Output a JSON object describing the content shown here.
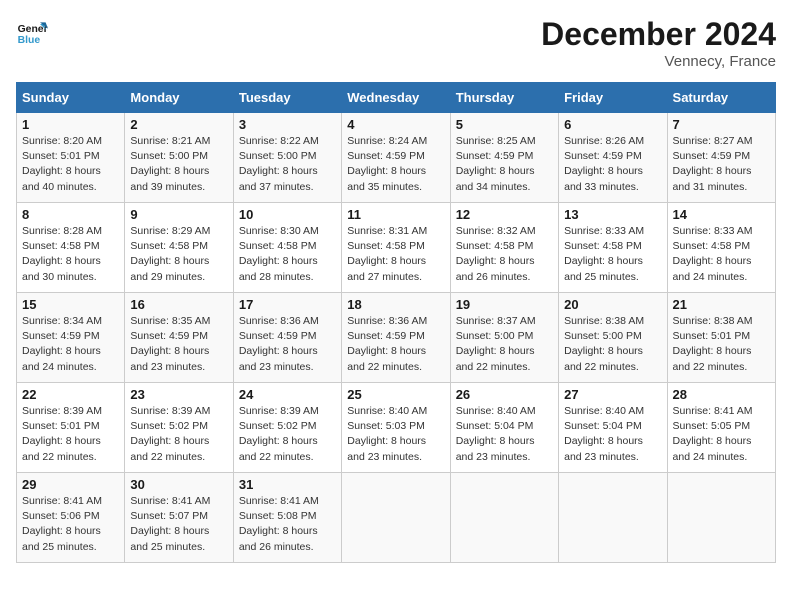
{
  "header": {
    "logo_line1": "General",
    "logo_line2": "Blue",
    "month": "December 2024",
    "location": "Vennecy, France"
  },
  "days_of_week": [
    "Sunday",
    "Monday",
    "Tuesday",
    "Wednesday",
    "Thursday",
    "Friday",
    "Saturday"
  ],
  "weeks": [
    [
      {
        "day": "1",
        "sunrise": "8:20 AM",
        "sunset": "5:01 PM",
        "daylight": "8 hours and 40 minutes."
      },
      {
        "day": "2",
        "sunrise": "8:21 AM",
        "sunset": "5:00 PM",
        "daylight": "8 hours and 39 minutes."
      },
      {
        "day": "3",
        "sunrise": "8:22 AM",
        "sunset": "5:00 PM",
        "daylight": "8 hours and 37 minutes."
      },
      {
        "day": "4",
        "sunrise": "8:24 AM",
        "sunset": "4:59 PM",
        "daylight": "8 hours and 35 minutes."
      },
      {
        "day": "5",
        "sunrise": "8:25 AM",
        "sunset": "4:59 PM",
        "daylight": "8 hours and 34 minutes."
      },
      {
        "day": "6",
        "sunrise": "8:26 AM",
        "sunset": "4:59 PM",
        "daylight": "8 hours and 33 minutes."
      },
      {
        "day": "7",
        "sunrise": "8:27 AM",
        "sunset": "4:59 PM",
        "daylight": "8 hours and 31 minutes."
      }
    ],
    [
      {
        "day": "8",
        "sunrise": "8:28 AM",
        "sunset": "4:58 PM",
        "daylight": "8 hours and 30 minutes."
      },
      {
        "day": "9",
        "sunrise": "8:29 AM",
        "sunset": "4:58 PM",
        "daylight": "8 hours and 29 minutes."
      },
      {
        "day": "10",
        "sunrise": "8:30 AM",
        "sunset": "4:58 PM",
        "daylight": "8 hours and 28 minutes."
      },
      {
        "day": "11",
        "sunrise": "8:31 AM",
        "sunset": "4:58 PM",
        "daylight": "8 hours and 27 minutes."
      },
      {
        "day": "12",
        "sunrise": "8:32 AM",
        "sunset": "4:58 PM",
        "daylight": "8 hours and 26 minutes."
      },
      {
        "day": "13",
        "sunrise": "8:33 AM",
        "sunset": "4:58 PM",
        "daylight": "8 hours and 25 minutes."
      },
      {
        "day": "14",
        "sunrise": "8:33 AM",
        "sunset": "4:58 PM",
        "daylight": "8 hours and 24 minutes."
      }
    ],
    [
      {
        "day": "15",
        "sunrise": "8:34 AM",
        "sunset": "4:59 PM",
        "daylight": "8 hours and 24 minutes."
      },
      {
        "day": "16",
        "sunrise": "8:35 AM",
        "sunset": "4:59 PM",
        "daylight": "8 hours and 23 minutes."
      },
      {
        "day": "17",
        "sunrise": "8:36 AM",
        "sunset": "4:59 PM",
        "daylight": "8 hours and 23 minutes."
      },
      {
        "day": "18",
        "sunrise": "8:36 AM",
        "sunset": "4:59 PM",
        "daylight": "8 hours and 22 minutes."
      },
      {
        "day": "19",
        "sunrise": "8:37 AM",
        "sunset": "5:00 PM",
        "daylight": "8 hours and 22 minutes."
      },
      {
        "day": "20",
        "sunrise": "8:38 AM",
        "sunset": "5:00 PM",
        "daylight": "8 hours and 22 minutes."
      },
      {
        "day": "21",
        "sunrise": "8:38 AM",
        "sunset": "5:01 PM",
        "daylight": "8 hours and 22 minutes."
      }
    ],
    [
      {
        "day": "22",
        "sunrise": "8:39 AM",
        "sunset": "5:01 PM",
        "daylight": "8 hours and 22 minutes."
      },
      {
        "day": "23",
        "sunrise": "8:39 AM",
        "sunset": "5:02 PM",
        "daylight": "8 hours and 22 minutes."
      },
      {
        "day": "24",
        "sunrise": "8:39 AM",
        "sunset": "5:02 PM",
        "daylight": "8 hours and 22 minutes."
      },
      {
        "day": "25",
        "sunrise": "8:40 AM",
        "sunset": "5:03 PM",
        "daylight": "8 hours and 23 minutes."
      },
      {
        "day": "26",
        "sunrise": "8:40 AM",
        "sunset": "5:04 PM",
        "daylight": "8 hours and 23 minutes."
      },
      {
        "day": "27",
        "sunrise": "8:40 AM",
        "sunset": "5:04 PM",
        "daylight": "8 hours and 23 minutes."
      },
      {
        "day": "28",
        "sunrise": "8:41 AM",
        "sunset": "5:05 PM",
        "daylight": "8 hours and 24 minutes."
      }
    ],
    [
      {
        "day": "29",
        "sunrise": "8:41 AM",
        "sunset": "5:06 PM",
        "daylight": "8 hours and 25 minutes."
      },
      {
        "day": "30",
        "sunrise": "8:41 AM",
        "sunset": "5:07 PM",
        "daylight": "8 hours and 25 minutes."
      },
      {
        "day": "31",
        "sunrise": "8:41 AM",
        "sunset": "5:08 PM",
        "daylight": "8 hours and 26 minutes."
      },
      null,
      null,
      null,
      null
    ]
  ]
}
